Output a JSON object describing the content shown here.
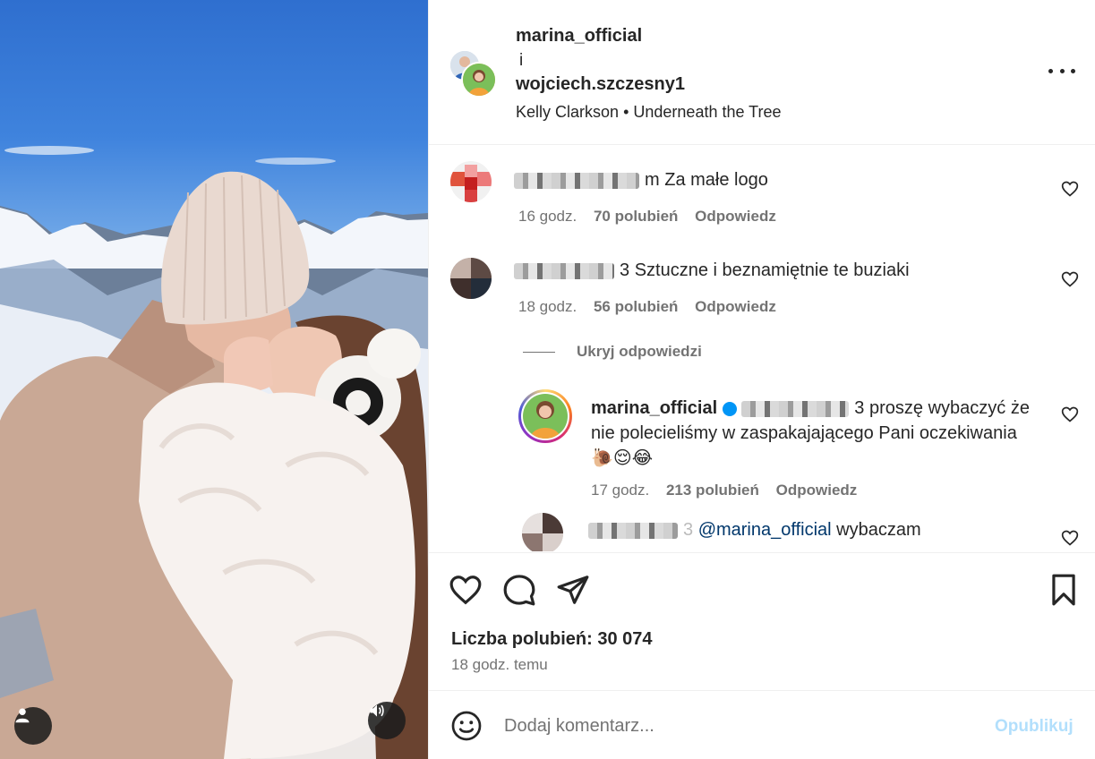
{
  "post_header": {
    "user1": "marina_official",
    "and": "i",
    "user2": "wojciech.szczesny1",
    "audio_artist": "Kelly Clarkson",
    "audio_separator": "•",
    "audio_title": "Underneath the Tree"
  },
  "comments": [
    {
      "username_tail": "m",
      "text": "Za małe logo",
      "time": "16 godz.",
      "likes": "70 polubień",
      "reply": "Odpowiedz"
    },
    {
      "username_tail": "3",
      "text": "Sztuczne i beznamiętnie te buziaki",
      "time": "18 godz.",
      "likes": "56 polubień",
      "reply": "Odpowiedz"
    }
  ],
  "hide_replies": "Ukryj odpowiedzi",
  "replies": [
    {
      "username": "marina_official",
      "mention_tail": "3",
      "text": "proszę wybaczyć że nie polecieliśmy w zaspakajającego Pani oczekiwania",
      "emojis": "🐌😌😂",
      "time": "17 godz.",
      "likes": "213 polubień",
      "reply": "Odpowiedz"
    },
    {
      "username_tail": "3",
      "mention": "@marina_official",
      "text": "wybaczam"
    }
  ],
  "likes_summary": {
    "label": "Liczba polubień:",
    "count": "30 074"
  },
  "posted_ago": "18 godz. temu",
  "composer": {
    "placeholder": "Dodaj komentarz...",
    "publish": "Opublikuj"
  },
  "colors": {
    "accent": "#0095f6",
    "publish_disabled": "#b2dffc",
    "muted_text": "#737373",
    "mention": "#00376b"
  }
}
